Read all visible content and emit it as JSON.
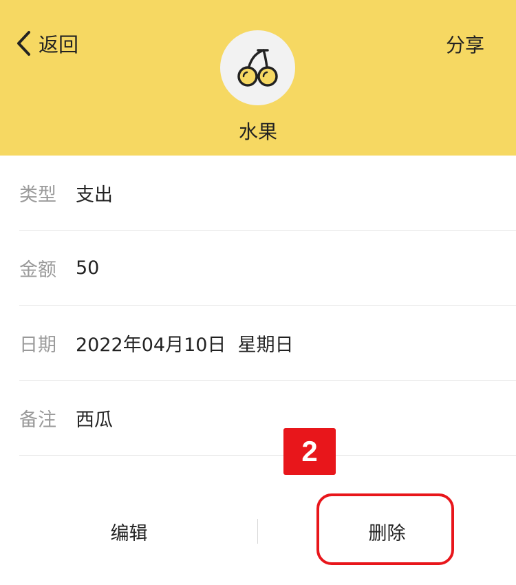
{
  "header": {
    "back_label": "返回",
    "share_label": "分享",
    "category_icon": "cherry-icon",
    "category_name": "水果",
    "background_color": "#f6d862"
  },
  "details": [
    {
      "label": "类型",
      "value": "支出"
    },
    {
      "label": "金额",
      "value": "50"
    },
    {
      "label": "日期",
      "value": "2022年04月10日  星期日"
    },
    {
      "label": "备注",
      "value": "西瓜"
    }
  ],
  "actions": {
    "edit_label": "编辑",
    "delete_label": "删除"
  },
  "annotation": {
    "marker_number": "2",
    "color": "#e8161b"
  }
}
